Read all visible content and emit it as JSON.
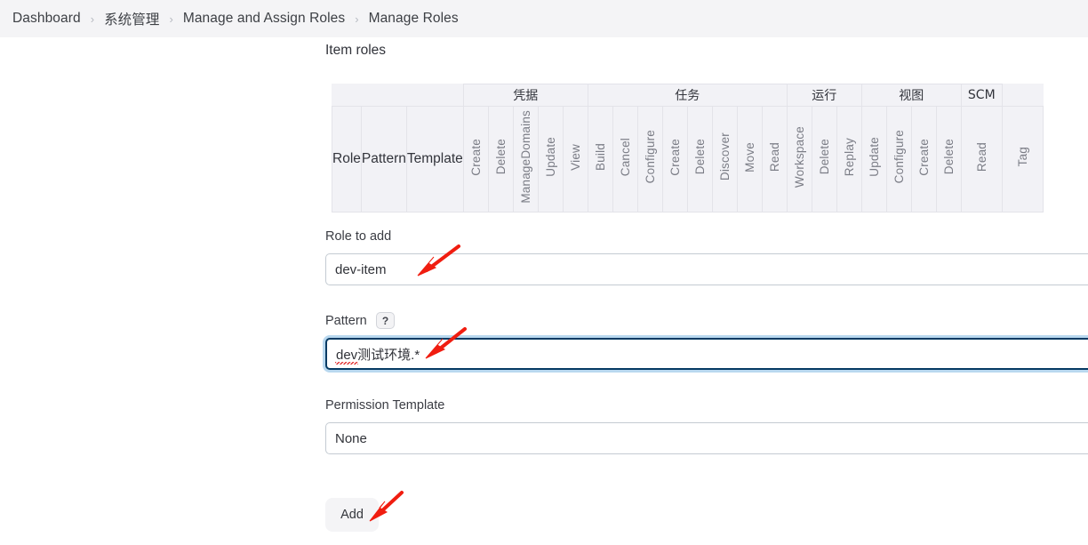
{
  "breadcrumb": {
    "separator": "›",
    "items": [
      {
        "label": "Dashboard"
      },
      {
        "label": "系统管理"
      },
      {
        "label": "Manage and Assign Roles"
      },
      {
        "label": "Manage Roles"
      }
    ]
  },
  "section": {
    "title": "Item roles"
  },
  "matrix": {
    "row_headers": [
      "Role",
      "Pattern",
      "Template"
    ],
    "groups": [
      {
        "label": "凭据",
        "span": 5
      },
      {
        "label": "任务",
        "span": 8
      },
      {
        "label": "运行",
        "span": 3
      },
      {
        "label": "视图",
        "span": 4
      },
      {
        "label": "SCM",
        "span": 1
      }
    ],
    "columns": [
      "Create",
      "Delete",
      "ManageDomains",
      "Update",
      "View",
      "Build",
      "Cancel",
      "Configure",
      "Create",
      "Delete",
      "Discover",
      "Move",
      "Read",
      "Workspace",
      "Delete",
      "Replay",
      "Update",
      "Configure",
      "Create",
      "Delete",
      "Read",
      "Tag"
    ]
  },
  "form": {
    "role_to_add": {
      "label": "Role to add",
      "value": "dev-item",
      "placeholder": ""
    },
    "pattern": {
      "label": "Pattern",
      "help_icon": "question-mark-icon",
      "help_text": "?",
      "value": "dev测试环境.*",
      "placeholder": ""
    },
    "permission_template": {
      "label": "Permission Template",
      "value": "None",
      "options": [
        "None"
      ]
    },
    "add_button": {
      "label": "Add"
    }
  },
  "annotations": {
    "color": "#f01d10",
    "arrows": [
      {
        "name": "arrow-role-to-add"
      },
      {
        "name": "arrow-pattern"
      },
      {
        "name": "arrow-add-button"
      }
    ]
  }
}
